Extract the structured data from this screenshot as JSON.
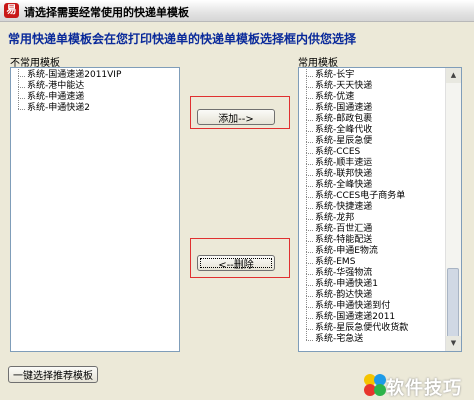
{
  "window": {
    "title": "请选择需要经常使用的快递单模板",
    "app_icon_glyph": "易"
  },
  "hint": "常用快递单模板会在您打印快递单的快递单模板选择框内供您选择",
  "left_panel": {
    "label": "不常用模板",
    "items": [
      "系统-国通速递2011VIP",
      "系统-港中能达",
      "系统-申通速递",
      "系统-申通快递2"
    ]
  },
  "right_panel": {
    "label": "常用模板",
    "items": [
      "系统-长宇",
      "系统-天天快递",
      "系统-优速",
      "系统-国通速递",
      "系统-邮政包裹",
      "系统-全峰代收",
      "系统-星辰急便",
      "系统-CCES",
      "系统-顺丰速运",
      "系统-联邦快递",
      "系统-全峰快递",
      "系统-CCES电子商务单",
      "系统-快捷速递",
      "系统-龙邦",
      "系统-百世汇通",
      "系统-特能配送",
      "系统-申通E物流",
      "系统-EMS",
      "系统-华强物流",
      "系统-申通快递1",
      "系统-韵达快递",
      "系统-申通快递到付",
      "系统-国通速递2011",
      "系统-星辰急便代收货款",
      "系统-宅急送"
    ]
  },
  "buttons": {
    "add": "添加-->",
    "delete": "<--删除",
    "select_recommended": "一键选择推荐模板"
  },
  "watermark": {
    "text": "软件技巧",
    "logo_colors": [
      "#f5c400",
      "#1e9be8",
      "#e8352c",
      "#2db34a"
    ]
  }
}
